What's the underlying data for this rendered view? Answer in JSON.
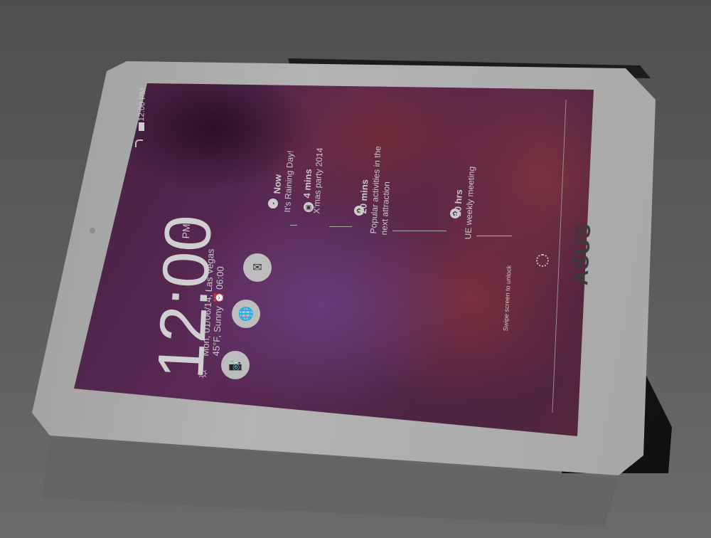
{
  "status_bar": {
    "time": "12:00 PM"
  },
  "clock": {
    "time": "12:00",
    "ampm": "PM",
    "date_line": "Mon, 01/06/14, Las Vegas",
    "weather_line": "45°F, Sunny",
    "alarm": "06:00"
  },
  "notifications": [
    {
      "when": "Now",
      "text": "It's Raining Day!"
    },
    {
      "when": "4 mins",
      "text": "X'mas party 2014"
    },
    {
      "when": "20 mins",
      "text": "Popular activities in the",
      "text2": "next attraction"
    },
    {
      "when": "10 hrs",
      "text": "UE weekly meeting"
    }
  ],
  "unlock_hint": "Swipe screen to unlock",
  "brand": "ASUS"
}
